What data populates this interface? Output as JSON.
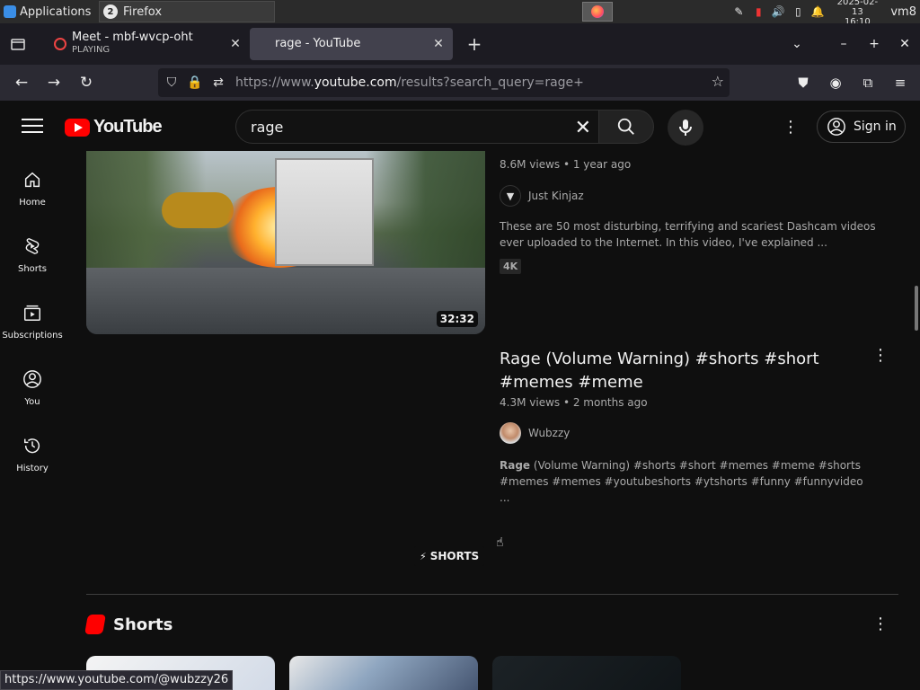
{
  "os": {
    "apps_label": "Applications",
    "task_badge": "2",
    "task_label": "Firefox",
    "date": "2025-02-13",
    "time": "16:10",
    "user": "vm8"
  },
  "tabs": [
    {
      "title": "Meet - mbf-wvcp-oht",
      "subtitle": "PLAYING",
      "active": false
    },
    {
      "title": "rage - YouTube",
      "subtitle": "",
      "active": true
    }
  ],
  "url": {
    "prefix": "https://www.",
    "host": "youtube.com",
    "path": "/results?search_query=rage+"
  },
  "youtube": {
    "logo_text": "YouTube",
    "search_value": "rage",
    "signin_label": "Sign in",
    "guide": [
      {
        "label": "Home",
        "icon": "home-icon"
      },
      {
        "label": "Shorts",
        "icon": "shorts-icon"
      },
      {
        "label": "Subscriptions",
        "icon": "subscriptions-icon"
      },
      {
        "label": "You",
        "icon": "you-icon"
      },
      {
        "label": "History",
        "icon": "history-icon"
      }
    ],
    "video1": {
      "duration": "32:32",
      "meta": "8.6M views • 1 year ago",
      "channel": "Just Kinjaz",
      "description": "These are 50 most disturbing, terrifying and scariest Dashcam videos ever uploaded to the Internet. In this video, I've explained ...",
      "badge": "4K"
    },
    "video2": {
      "title": "Rage (Volume Warning) #shorts #short #memes #meme",
      "meta": "4.3M views • 2 months ago",
      "channel": "Wubzzy",
      "description_bold": "Rage",
      "description_rest": " (Volume Warning) #shorts #short #memes #meme #shorts #memes #memes #youtubeshorts #ytshorts #funny #funnyvideo ..."
    },
    "shorts_chip": "SHORTS",
    "shorts_heading": "Shorts"
  },
  "status_url": "https://www.youtube.com/@wubzzy26",
  "colors": {
    "accent": "#ff0000",
    "background": "#0f0f0f"
  }
}
